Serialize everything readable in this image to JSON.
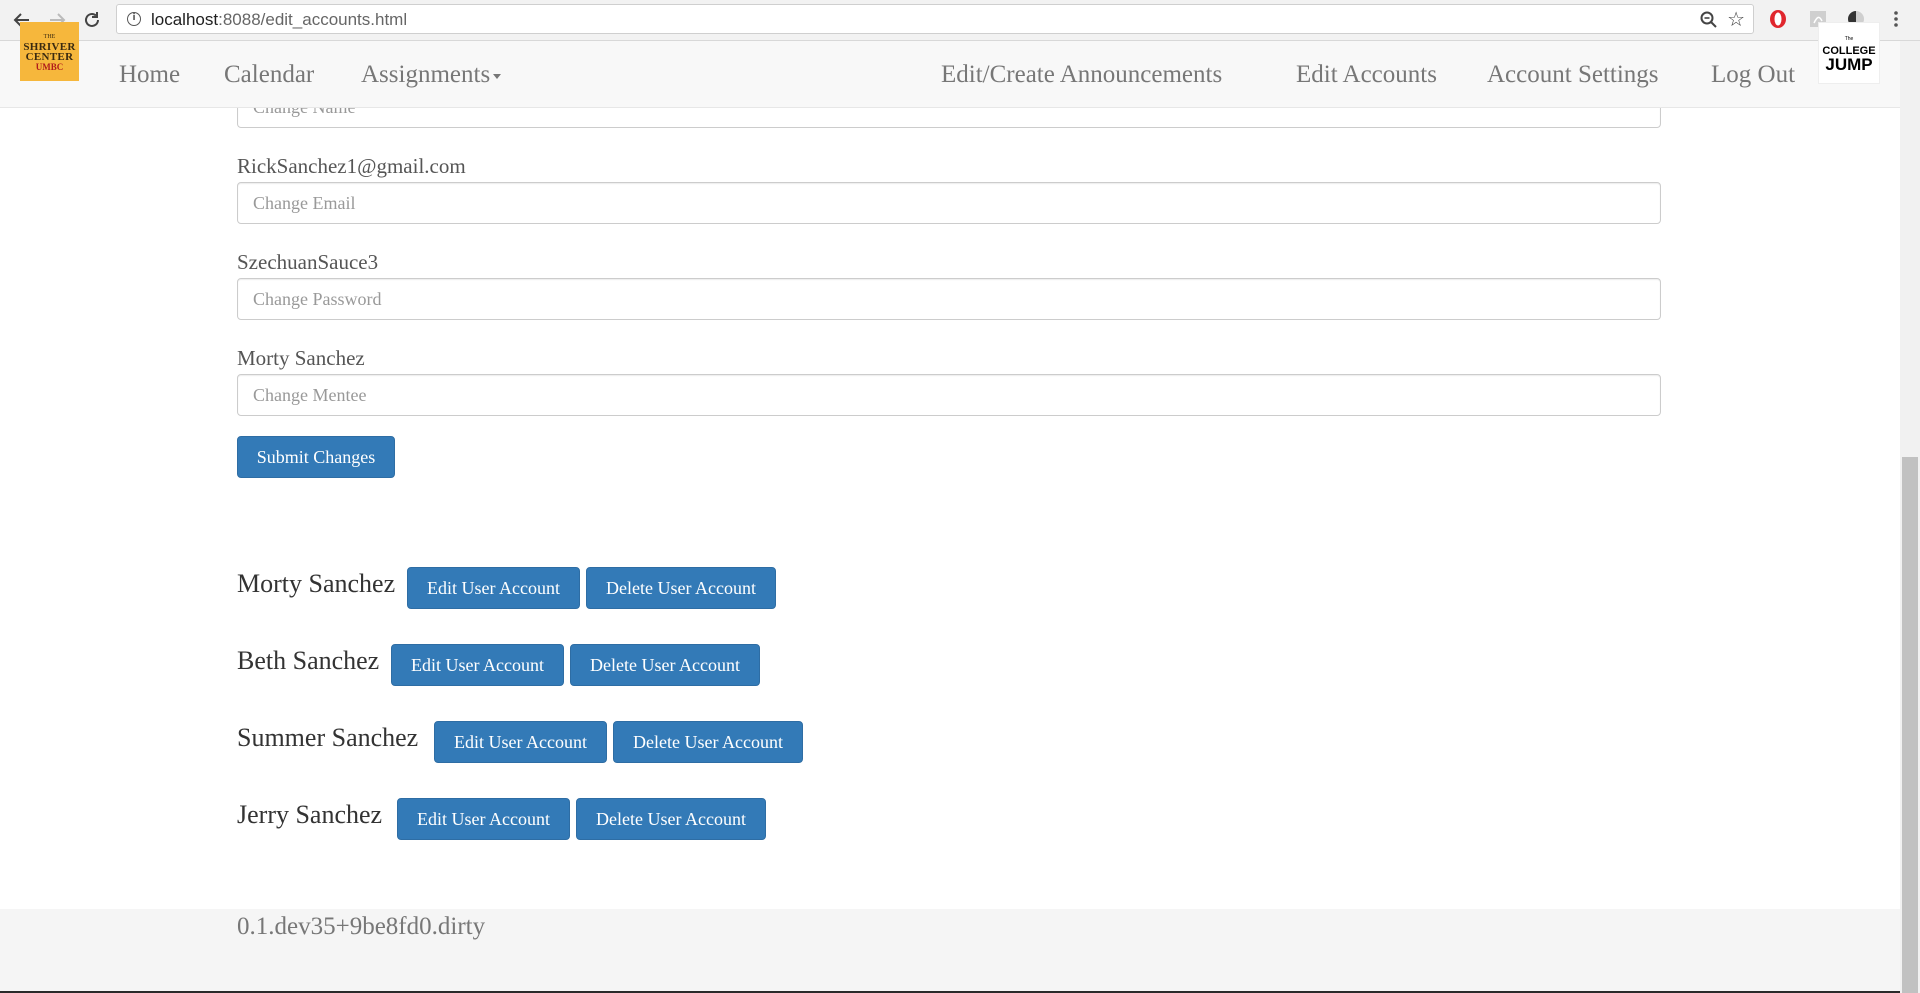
{
  "browser": {
    "url": "localhost:8088/edit_accounts.html",
    "url_host": "localhost",
    "url_rest": ":8088/edit_accounts.html"
  },
  "navbar": {
    "logo_left": {
      "line1": "THE",
      "line2": "SHRIVER",
      "line3": "CENTER",
      "line4": "UMBC"
    },
    "home": "Home",
    "calendar": "Calendar",
    "assignments": "Assignments",
    "announcements": "Edit/Create Announcements",
    "edit_accounts": "Edit Accounts",
    "account_settings": "Account Settings",
    "log_out": "Log Out",
    "logo_right": {
      "line1": "The",
      "line2": "COLLEGE",
      "line3": "JUMP",
      "line4": ""
    }
  },
  "form": {
    "name_placeholder": "Change Name",
    "email_current": "RickSanchez1@gmail.com",
    "email_placeholder": "Change Email",
    "password_current": "SzechuanSauce3",
    "password_placeholder": "Change Password",
    "mentee_current": "Morty Sanchez",
    "mentee_placeholder": "Change Mentee",
    "submit_label": "Submit Changes"
  },
  "users": [
    {
      "name": "Morty Sanchez",
      "edit_label": "Edit User Account",
      "delete_label": "Delete User Account"
    },
    {
      "name": "Beth Sanchez",
      "edit_label": "Edit User Account",
      "delete_label": "Delete User Account"
    },
    {
      "name": "Summer Sanchez",
      "edit_label": "Edit User Account",
      "delete_label": "Delete User Account"
    },
    {
      "name": "Jerry Sanchez",
      "edit_label": "Edit User Account",
      "delete_label": "Delete User Account"
    }
  ],
  "footer": {
    "version": "0.1.dev35+9be8fd0.dirty"
  },
  "colors": {
    "primary": "#337ab7",
    "navbar_bg": "#f8f8f8",
    "nav_text": "#777777"
  }
}
